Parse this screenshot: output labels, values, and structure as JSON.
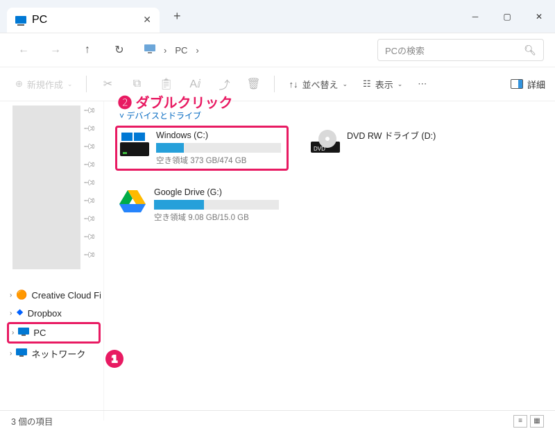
{
  "tab": {
    "title": "PC"
  },
  "address": {
    "root": "PC"
  },
  "search": {
    "placeholder": "PCの検索"
  },
  "toolbar": {
    "new": "新規作成",
    "sort": "並べ替え",
    "view": "表示",
    "details": "詳細"
  },
  "section": {
    "drives": "デバイスとドライブ"
  },
  "drives": {
    "c": {
      "name": "Windows (C:)",
      "space": "空き領域 373 GB/474 GB",
      "fill_pct": 22
    },
    "d": {
      "name": "DVD RW ドライブ (D:)"
    },
    "g": {
      "name": "Google Drive (G:)",
      "space": "空き領域 9.08 GB/15.0 GB",
      "fill_pct": 40
    }
  },
  "sidebar": {
    "items": {
      "0": {
        "label": "Creative Cloud Files"
      },
      "1": {
        "label": "Dropbox"
      },
      "2": {
        "label": "PC"
      },
      "3": {
        "label": "ネットワーク"
      }
    }
  },
  "status": {
    "text": "3 個の項目"
  },
  "annotations": {
    "a1": "1",
    "a2": "❷ ダブルクリック"
  }
}
